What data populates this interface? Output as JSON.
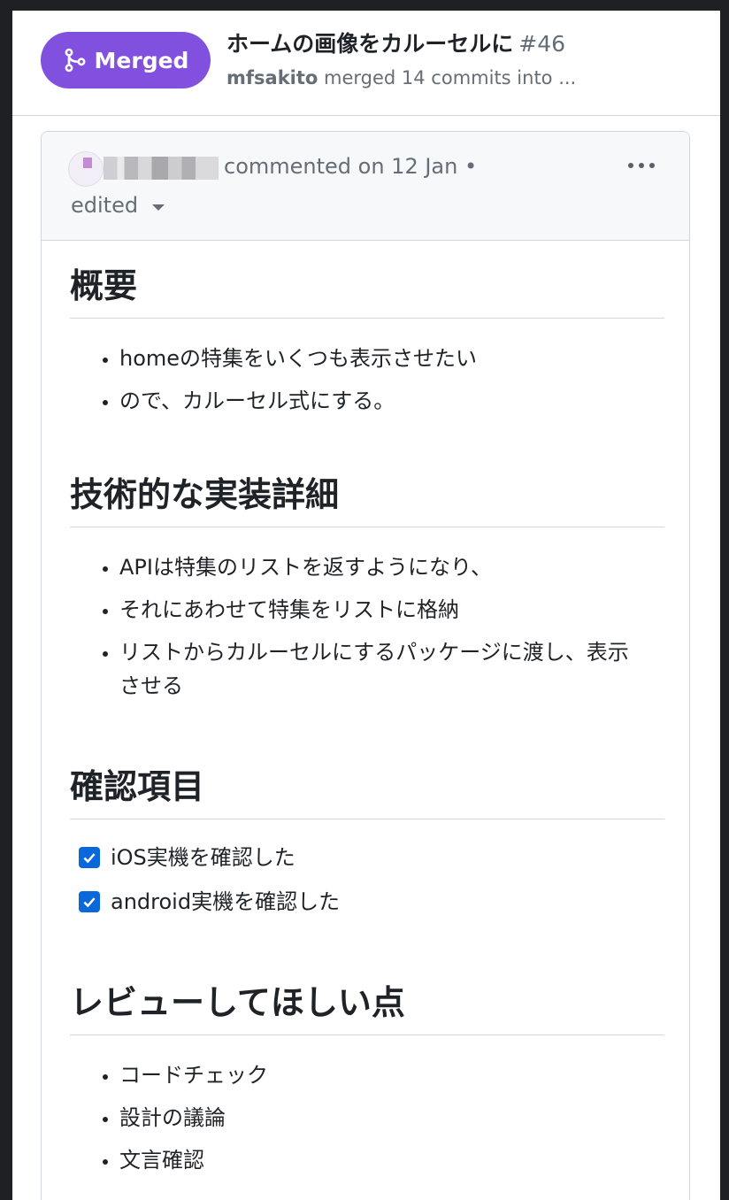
{
  "header": {
    "badge_label": "Merged",
    "title": "ホームの画像をカルーセルに",
    "number": "#46",
    "author": "mfsakito",
    "subtitle_rest": "merged 14 commits into ..."
  },
  "comment": {
    "meta": "commented on 12 Jan •",
    "edited_label": "edited"
  },
  "sections": [
    {
      "heading": "概要",
      "items": [
        "homeの特集をいくつも表示させたい",
        "ので、カルーセル式にする。"
      ]
    },
    {
      "heading": "技術的な実装詳細",
      "items": [
        "APIは特集のリストを返すようになり、",
        "それにあわせて特集をリストに格納",
        "リストからカルーセルにするパッケージに渡し、表示させる"
      ]
    },
    {
      "heading": "確認項目",
      "tasks": [
        {
          "label": "iOS実機を確認した",
          "checked": true
        },
        {
          "label": "android実機を確認した",
          "checked": true
        }
      ]
    },
    {
      "heading": "レビューしてほしい点",
      "items": [
        "コードチェック",
        "設計の議論",
        "文言確認"
      ]
    }
  ],
  "colors": {
    "merged": "#8250df",
    "checkbox": "#0969da"
  },
  "icons": {
    "badge": "git-merge-icon",
    "menu": "kebab-horizontal-icon",
    "dropdown": "triangle-down-icon",
    "check": "check-icon"
  }
}
